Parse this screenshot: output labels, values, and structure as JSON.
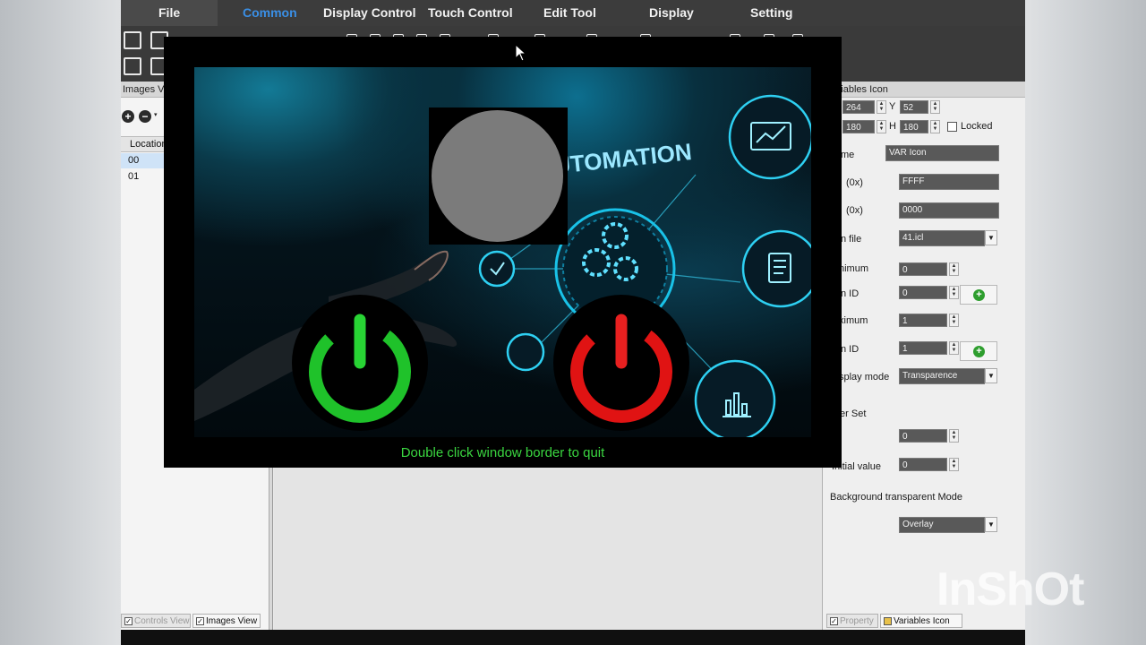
{
  "menu": {
    "items": [
      "File",
      "Common",
      "Display Control",
      "Touch Control",
      "Edit Tool",
      "Display",
      "Setting"
    ],
    "active": "Common"
  },
  "left_panel": {
    "title": "Images Vie",
    "column_header": "Location",
    "rows": [
      "00",
      "01"
    ],
    "tabs": [
      "Controls View",
      "Images View"
    ]
  },
  "right_panel": {
    "title": "Variables Icon",
    "x_value": "264",
    "y_label": "Y",
    "y_value": "52",
    "w_value": "180",
    "h_label": "H",
    "h_value": "180",
    "locked_label": "Locked",
    "fields": {
      "name_label": "me",
      "name_value": "VAR Icon",
      "addr1_label": "(0x)",
      "addr1_value": "FFFF",
      "addr2_label": "(0x)",
      "addr2_value": "0000",
      "iconfile_label": "n file",
      "iconfile_value": "41.icl",
      "minimum_label": "nimum",
      "minimum_value": "0",
      "iconid1_label": "n ID",
      "iconid1_value": "0",
      "maximum_label": "ximum",
      "maximum_value": "1",
      "iconid2_label": "n ID",
      "iconid2_value": "1",
      "display_mode_label": "splay mode",
      "display_mode_value": "Transparence",
      "filter_set_label": "ter Set",
      "filter_value": "0",
      "initial_label": "Initial value",
      "initial_value": "0",
      "bg_mode_label": "Background transparent Mode",
      "bg_mode_value": "Overlay"
    },
    "tabs": [
      "Property",
      "Variables Icon"
    ]
  },
  "preview": {
    "headline": "AUTOMATION",
    "quit_message": "Double click window border to quit"
  },
  "watermark": "InShOt",
  "colors": {
    "menu_active": "#3a8fe6",
    "power_on": "#1fc22a",
    "power_off": "#e01313",
    "quit_text": "#3ad640"
  }
}
